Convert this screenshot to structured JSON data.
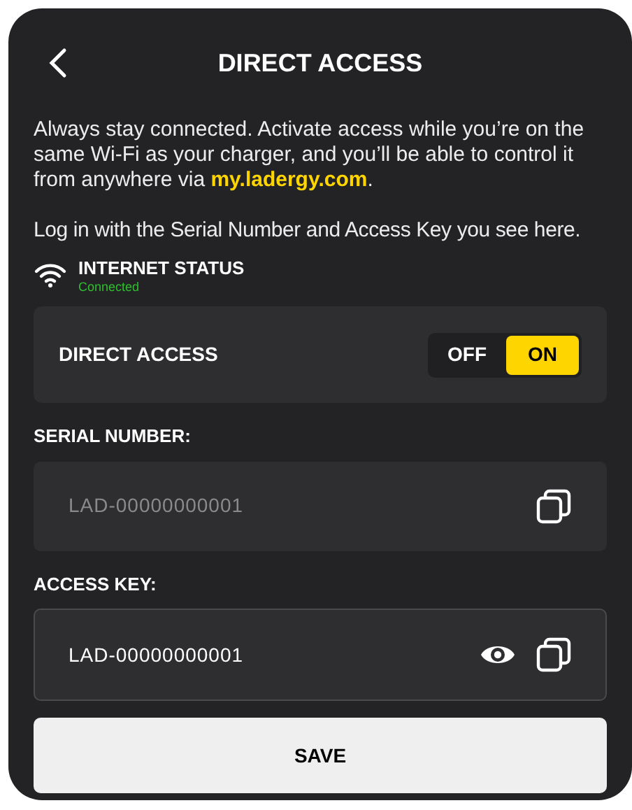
{
  "header": {
    "title": "DIRECT ACCESS"
  },
  "intro": {
    "before": "Always stay connected. Activate access while you’re on the same Wi-Fi as your charger, and you’ll be able to control it from anywhere via ",
    "link": "my.ladergy.com",
    "after": "."
  },
  "login_hint": "Log in with the Serial Number and Access Key you see here.",
  "internet_status": {
    "label": "INTERNET STATUS",
    "status": "Connected"
  },
  "direct_access": {
    "label": "DIRECT ACCESS",
    "options": [
      {
        "label": "OFF",
        "selected": false
      },
      {
        "label": "ON",
        "selected": true
      }
    ]
  },
  "fields": [
    {
      "label": "SERIAL NUMBER:",
      "value": "LAD-00000000001",
      "disabled": true,
      "show_reveal": false
    },
    {
      "label": "ACCESS KEY:",
      "value": "LAD-00000000001",
      "disabled": false,
      "show_reveal": true
    }
  ],
  "save_button": "SAVE"
}
